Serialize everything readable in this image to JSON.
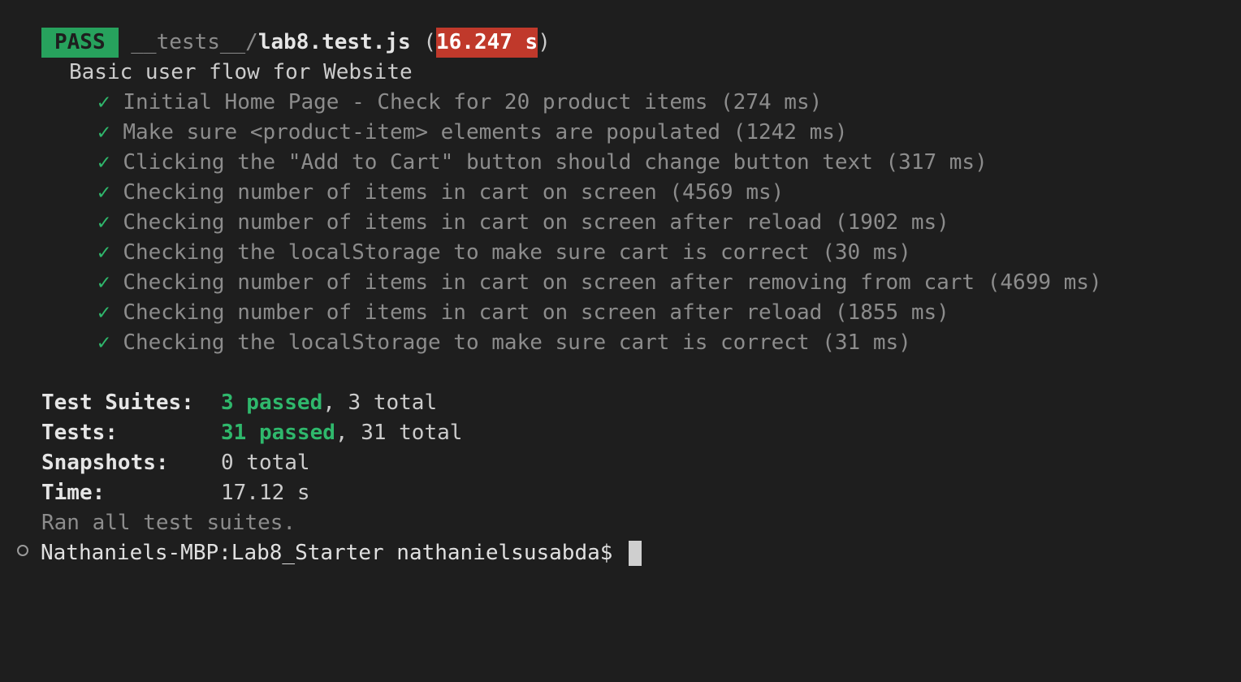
{
  "header": {
    "status": "PASS",
    "path_prefix": "__tests__/",
    "file_name": "lab8.test.js",
    "open_paren": "(",
    "duration": "16.247 s",
    "close_paren": ")"
  },
  "suite": {
    "title": "Basic user flow for Website",
    "check_mark": "✓",
    "tests": [
      "Initial Home Page - Check for 20 product items (274 ms)",
      "Make sure <product-item> elements are populated (1242 ms)",
      "Clicking the \"Add to Cart\" button should change button text (317 ms)",
      "Checking number of items in cart on screen (4569 ms)",
      "Checking number of items in cart on screen after reload (1902 ms)",
      "Checking the localStorage to make sure cart is correct (30 ms)",
      "Checking number of items in cart on screen after removing from cart (4699 ms)",
      "Checking number of items in cart on screen after reload (1855 ms)",
      "Checking the localStorage to make sure cart is correct (31 ms)"
    ]
  },
  "summary": {
    "suites_label": "Test Suites:",
    "suites_passed": "3 passed",
    "suites_total": ", 3 total",
    "tests_label": "Tests:",
    "tests_passed": "31 passed",
    "tests_total": ", 31 total",
    "snapshots_label": "Snapshots:",
    "snapshots_value": "0 total",
    "time_label": "Time:",
    "time_value": "17.12 s",
    "ran_all": "Ran all test suites."
  },
  "prompt": {
    "text": "Nathaniels-MBP:Lab8_Starter nathanielsusabda$ "
  },
  "colors": {
    "background": "#1e1e1e",
    "pass_badge": "#27a25d",
    "time_badge": "#c0392b",
    "check_green": "#2fb86c"
  }
}
